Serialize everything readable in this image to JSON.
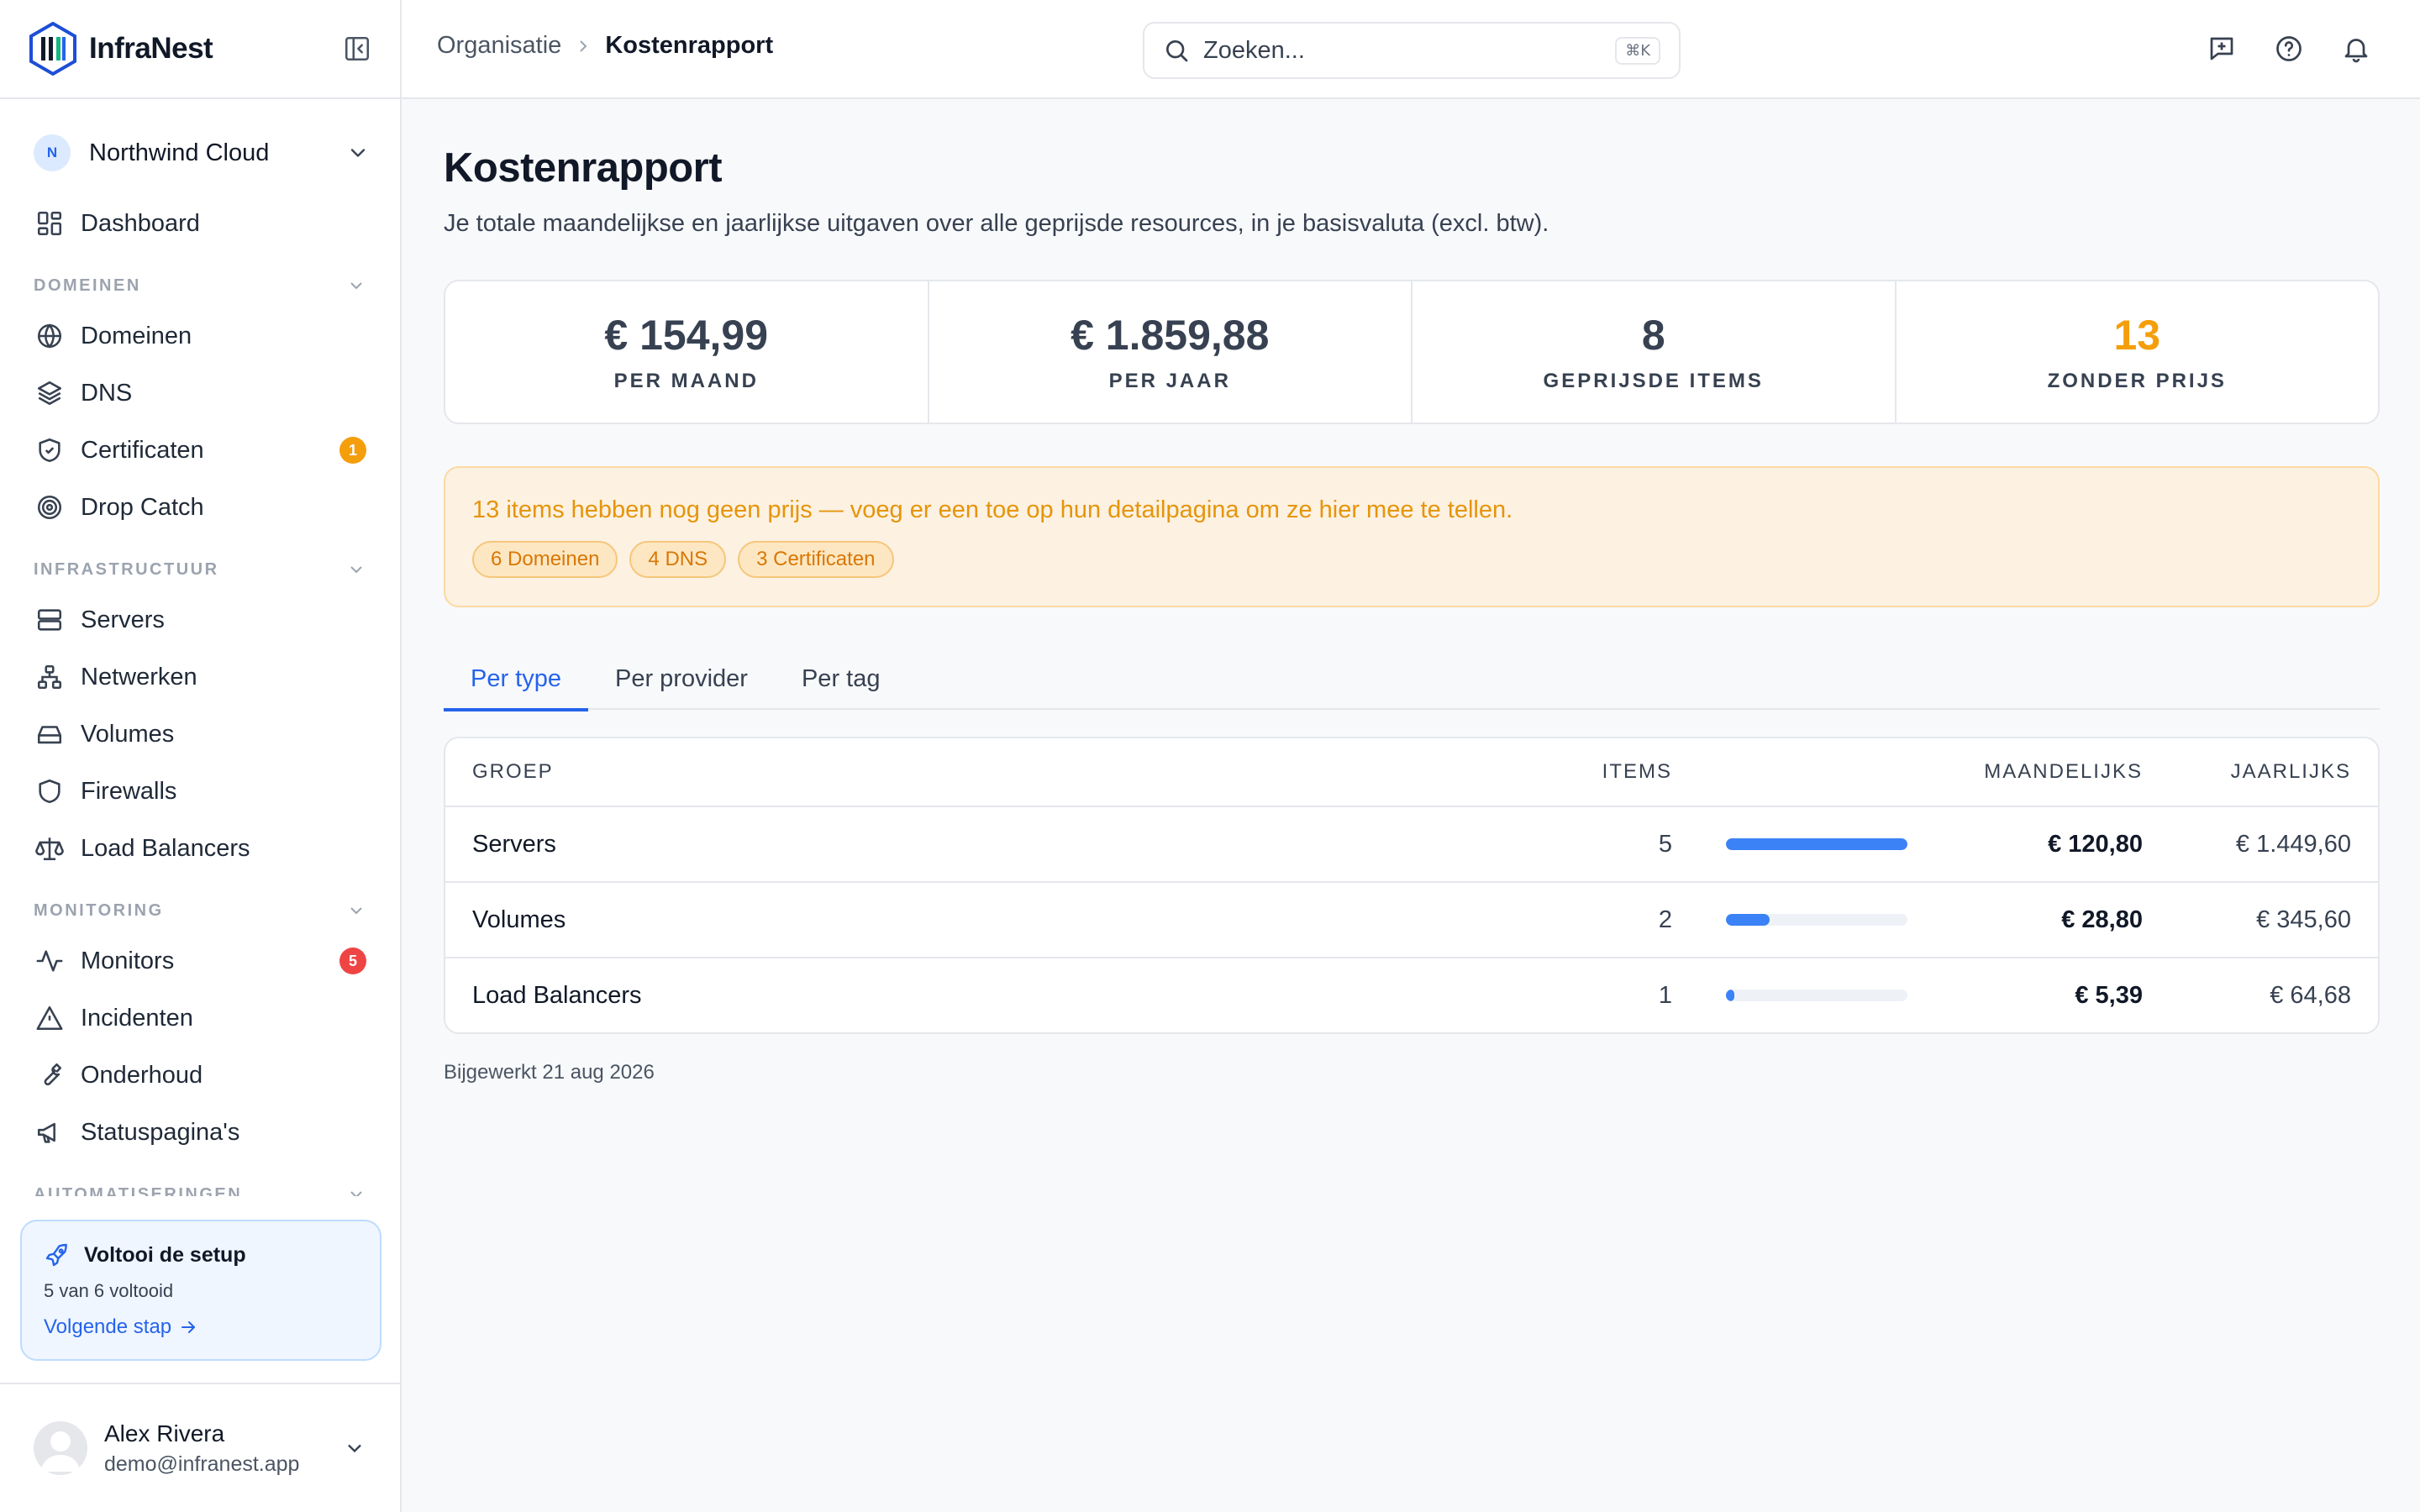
{
  "brand": {
    "name": "InfraNest"
  },
  "org": {
    "initial": "N",
    "name": "Northwind Cloud"
  },
  "nav": {
    "dashboard": "Dashboard",
    "sections": {
      "domeinen": "DOMEINEN",
      "infrastructuur": "INFRASTRUCTUUR",
      "monitoring": "MONITORING",
      "automatiseringen": "AUTOMATISERINGEN"
    },
    "items": {
      "domeinen": "Domeinen",
      "dns": "DNS",
      "certificaten": "Certificaten",
      "certificaten_badge": "1",
      "drop_catch": "Drop Catch",
      "servers": "Servers",
      "netwerken": "Netwerken",
      "volumes": "Volumes",
      "firewalls": "Firewalls",
      "load_balancers": "Load Balancers",
      "monitors": "Monitors",
      "monitors_badge": "5",
      "incidenten": "Incidenten",
      "onderhoud": "Onderhoud",
      "statuspaginas": "Statuspagina's"
    }
  },
  "setup": {
    "title": "Voltooi de setup",
    "progress": "5 van 6 voltooid",
    "next": "Volgende stap"
  },
  "user": {
    "name": "Alex Rivera",
    "email": "demo@infranest.app"
  },
  "breadcrumb": {
    "parent": "Organisatie",
    "current": "Kostenrapport"
  },
  "search": {
    "placeholder": "Zoeken...",
    "shortcut": "⌘K"
  },
  "page": {
    "title": "Kostenrapport",
    "description": "Je totale maandelijkse en jaarlijkse uitgaven over alle geprijsde resources, in je basisvaluta (excl. btw)."
  },
  "stats": [
    {
      "value": "€ 154,99",
      "label": "PER MAAND",
      "color": "#374151"
    },
    {
      "value": "€ 1.859,88",
      "label": "PER JAAR",
      "color": "#374151"
    },
    {
      "value": "8",
      "label": "GEPRIJSDE ITEMS",
      "color": "#374151"
    },
    {
      "value": "13",
      "label": "ZONDER PRIJS",
      "color": "#f59e0b"
    }
  ],
  "warning": {
    "text": "13 items hebben nog geen prijs — voeg er een toe op hun detailpagina om ze hier mee te tellen.",
    "chips": [
      "6 Domeinen",
      "4 DNS",
      "3 Certificaten"
    ]
  },
  "tabs": [
    "Per type",
    "Per provider",
    "Per tag"
  ],
  "table": {
    "headers": {
      "group": "GROEP",
      "items": "ITEMS",
      "monthly": "MAANDELIJKS",
      "yearly": "JAARLIJKS"
    },
    "rows": [
      {
        "group": "Servers",
        "items": "5",
        "share": 1.0,
        "monthly": "€ 120,80",
        "yearly": "€ 1.449,60"
      },
      {
        "group": "Volumes",
        "items": "2",
        "share": 0.24,
        "monthly": "€ 28,80",
        "yearly": "€ 345,60"
      },
      {
        "group": "Load Balancers",
        "items": "1",
        "share": 0.045,
        "monthly": "€ 5,39",
        "yearly": "€ 64,68"
      }
    ]
  },
  "updated": "Bijgewerkt 21 aug 2026",
  "colors": {
    "accent": "#2563eb",
    "warning": "#f59e0b",
    "danger": "#ef4444"
  }
}
